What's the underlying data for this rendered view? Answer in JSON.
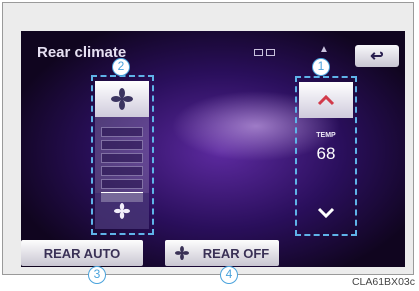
{
  "screen": {
    "title": "Rear climate",
    "back_label": "↩"
  },
  "fan": {
    "up_icon": "fan-large-icon",
    "down_icon": "fan-small-icon",
    "level": 1,
    "max_level": 6
  },
  "temp": {
    "label": "TEMP",
    "value": "68",
    "up_icon": "chevron-up-icon",
    "down_icon": "chevron-down-icon"
  },
  "buttons": {
    "rear_auto": "REAR AUTO",
    "rear_off": "REAR OFF"
  },
  "callouts": [
    "1",
    "2",
    "3",
    "4"
  ],
  "figure_code": "CLA61BX03c",
  "colors": {
    "callout": "#4aa3dc",
    "screen_bg": "#2a0f5c"
  }
}
